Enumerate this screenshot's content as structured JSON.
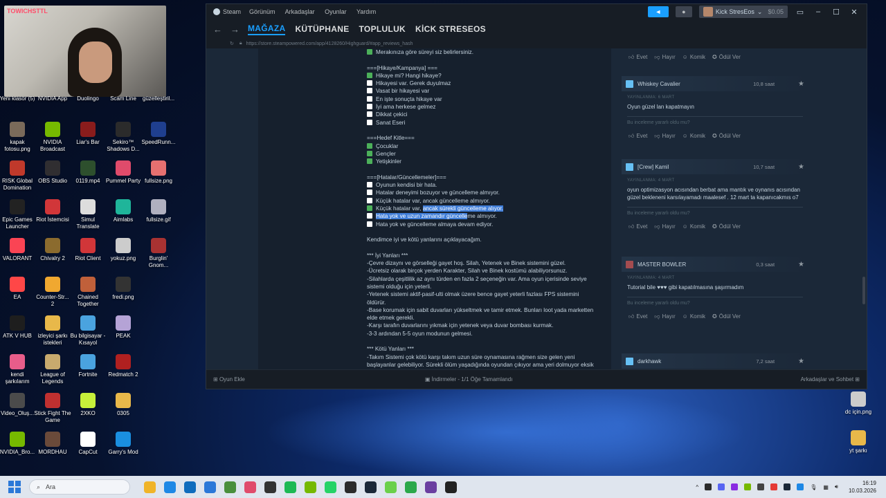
{
  "webcam": {
    "tag": "TOWICHSTTL"
  },
  "desktop_icons": [
    {
      "label": "Yeni klasör (5)",
      "color": "#e8b84a"
    },
    {
      "label": "NVIDIA App",
      "color": "#76b900"
    },
    {
      "label": "Duolingo",
      "color": "#58cc02"
    },
    {
      "label": "Scam Line",
      "color": "#444444"
    },
    {
      "label": "güzelleştiril...",
      "color": "#3a3a3a"
    },
    {
      "label": "kapak fotosu.png",
      "color": "#7a6a5a"
    },
    {
      "label": "NVIDIA Broadcast",
      "color": "#76b900"
    },
    {
      "label": "Liar's Bar",
      "color": "#8a1c1c"
    },
    {
      "label": "Sekiro™ Shadows D...",
      "color": "#2b2b2b"
    },
    {
      "label": "SpeedRunn...",
      "color": "#1f3f8f"
    },
    {
      "label": "RISK Global Domination",
      "color": "#c0392b"
    },
    {
      "label": "OBS Studio",
      "color": "#302e31"
    },
    {
      "label": "0119.mp4",
      "color": "#2d4f2d"
    },
    {
      "label": "Pummel Party",
      "color": "#e04b6b"
    },
    {
      "label": "fullsize.png",
      "color": "#e57070"
    },
    {
      "label": "Epic Games Launcher",
      "color": "#222222"
    },
    {
      "label": "Riot İstemcisi",
      "color": "#d13639"
    },
    {
      "label": "Simul Translate",
      "color": "#dddddd"
    },
    {
      "label": "Aimlabs",
      "color": "#1fb59a"
    },
    {
      "label": "fullsize.gif",
      "color": "#b0b0c0"
    },
    {
      "label": "VALORANT",
      "color": "#fa4454"
    },
    {
      "label": "Chivalry 2",
      "color": "#8b6b2e"
    },
    {
      "label": "Riot Client",
      "color": "#d13639"
    },
    {
      "label": "yokuz.png",
      "color": "#cccccc"
    },
    {
      "label": "Burglin' Gnom...",
      "color": "#a83232"
    },
    {
      "label": "EA",
      "color": "#ff4747"
    },
    {
      "label": "Counter-Str... 2",
      "color": "#f0a830"
    },
    {
      "label": "Chained Together",
      "color": "#c0603a"
    },
    {
      "label": "fredi.png",
      "color": "#333333"
    },
    {
      "label": "ATK V HUB",
      "color": "#1e1e1e"
    },
    {
      "label": "izleyici şarkı istekleri",
      "color": "#e8b84a"
    },
    {
      "label": "Bu bilgisayar - Kısayol",
      "color": "#4aa3df"
    },
    {
      "label": "PEAK",
      "color": "#b5a3d6"
    },
    {
      "label": "kendi şarkılarım",
      "color": "#e85d8a"
    },
    {
      "label": "League of Legends",
      "color": "#c8aa6e"
    },
    {
      "label": "Fortnite",
      "color": "#4aa3df"
    },
    {
      "label": "Redmatch 2",
      "color": "#b02020"
    },
    {
      "label": "Video_Oluş...",
      "color": "#4b4b4b"
    },
    {
      "label": "Stick Fight The Game",
      "color": "#c03030"
    },
    {
      "label": "2XKO",
      "color": "#c6f03a"
    },
    {
      "label": "0305",
      "color": "#e8b84a"
    },
    {
      "label": "NVIDIA_Bro...",
      "color": "#76b900"
    },
    {
      "label": "MORDHAU",
      "color": "#6a4a3a"
    },
    {
      "label": "CapCut",
      "color": "#ffffff"
    },
    {
      "label": "Garry's Mod",
      "color": "#1a8fe0"
    },
    {
      "label": "dc için.png",
      "color": "#cccccc"
    },
    {
      "label": "yt şarkı",
      "color": "#e8b84a"
    }
  ],
  "steam": {
    "title": "Steam",
    "menu": [
      "Görünüm",
      "Arkadaşlar",
      "Oyunlar",
      "Yardım"
    ],
    "user": "Kick StresEos",
    "balance": "$0.05",
    "nav_back": "←",
    "nav_forward": "→",
    "tabs": [
      "MAĞAZA",
      "KÜTÜPHANE",
      "TOPLULUK",
      "KİCK STRESEOS"
    ],
    "active_tab": "MAĞAZA",
    "url": "https://store.steampowered.com/app/4128260/Highguard/#app_reviews_hash",
    "review_lines": [
      {
        "cb": "on",
        "text": "Merakınıza göre süreyi siz belirlersiniz."
      },
      {
        "cb": "",
        "text": ""
      },
      {
        "cb": "",
        "text": "===[Hikaye/Kampanya] ==="
      },
      {
        "cb": "on",
        "text": "Hikaye mi? Hangi hikaye?"
      },
      {
        "cb": "off",
        "text": "Hikayesi var. Gerek duyulmaz"
      },
      {
        "cb": "off",
        "text": "Vasat bir hikayesi var"
      },
      {
        "cb": "off",
        "text": "En işte sonuçta hikaye var"
      },
      {
        "cb": "off",
        "text": "İyi ama herkese gelmez"
      },
      {
        "cb": "off",
        "text": "Dikkat çekici"
      },
      {
        "cb": "off",
        "text": "Sanat Eseri"
      },
      {
        "cb": "",
        "text": ""
      },
      {
        "cb": "",
        "text": "===Hedef Kitle==="
      },
      {
        "cb": "on",
        "text": "Çocuklar"
      },
      {
        "cb": "on",
        "text": "Gençler"
      },
      {
        "cb": "on",
        "text": "Yetişkinler"
      },
      {
        "cb": "",
        "text": ""
      },
      {
        "cb": "",
        "text": "===[Hatalar/Güncellemeler]==="
      },
      {
        "cb": "off",
        "text": "Oyunun kendisi bir hata."
      },
      {
        "cb": "off",
        "text": "Hatalar deneyimi bozuyor ve güncelleme almıyor."
      },
      {
        "cb": "off",
        "text": "Küçük hatalar var, ancak güncelleme almıyor."
      },
      {
        "cb": "on",
        "text": "Küçük hatalar var, ",
        "hl": "ancak sürekli güncelleme alıyor."
      },
      {
        "cb": "off",
        "text": "",
        "hl": "Hata yok ve uzun zamandır güncelle",
        "after": "me almıyor."
      },
      {
        "cb": "off",
        "text": "Hata yok ve güncelleme almaya devam ediyor."
      },
      {
        "cb": "",
        "text": ""
      },
      {
        "cb": "",
        "text": "Kendimce iyi ve kötü yanlarını açıklayacağım."
      },
      {
        "cb": "",
        "text": ""
      },
      {
        "cb": "",
        "text": "*** İyi Yanları ***"
      },
      {
        "cb": "",
        "text": "-Çevre dizaynı ve görselleği gayet hoş. Silah, Yetenek ve Binek sistemini güzel."
      },
      {
        "cb": "",
        "text": "-Ücretsiz olarak birçok yerden Karakter, Silah ve Binek kostümü alabiliyorsunuz."
      },
      {
        "cb": "",
        "text": "-Silahlarda çeşitlilik az aynı türden en fazla 2 seçeneğin var. Ama oyun içerisinde seviye"
      },
      {
        "cb": "",
        "text": "sistemi olduğu için yeterli."
      },
      {
        "cb": "",
        "text": "-Yetenek sistemi aktif-pasif-ulti olmak üzere bence gayet yeterli fazlası FPS sistemini"
      },
      {
        "cb": "",
        "text": "öldürür."
      },
      {
        "cb": "",
        "text": "-Base korumak için sabit duvarları yükseltmek ve tamir etmek. Bunları loot yada marketten"
      },
      {
        "cb": "",
        "text": "elde etmek gerekli."
      },
      {
        "cb": "",
        "text": "-Karşı tarafın duvarlarını yıkmak için yetenek veya duvar bombası kurmak."
      },
      {
        "cb": "",
        "text": "-3-3 ardından 5-5 oyun modunun gelmesi."
      },
      {
        "cb": "",
        "text": ""
      },
      {
        "cb": "",
        "text": "*** Kötü Yanları ***"
      },
      {
        "cb": "",
        "text": "-Takım Sistemi çok kötü karşı takım uzun süre oynamasına rağmen size gelen yeni"
      },
      {
        "cb": "",
        "text": "başlayanlar gelebiliyor. Sürekli ölüm yaşadığında oyundan çıkıyor ama yeri dolmuyor eksik"
      }
    ],
    "vote_labels": {
      "yes": "Evet",
      "no": "Hayır",
      "funny": "Komik",
      "award": "Ödül Ver"
    },
    "helpful_q": "Bu inceleme yararlı oldu mu?",
    "reviews": [
      {
        "name": "Whiskey Cavalier",
        "hours": "10,8 saat",
        "posted": "YAYINLANMA: 6 MART",
        "text": "Oyun güzel lan kapatmayın",
        "thumb": "up"
      },
      {
        "name": "[Crew] Kamil",
        "hours": "10,7 saat",
        "posted": "YAYINLANMA: 4 MART",
        "text": "oyun optimizasyon acısından berbat ama mantık ve oynanıs acısından güzel bekleneni karsılayamadı maalesef . 12 mart ta kapanıcakmıs o7",
        "thumb": "up"
      },
      {
        "name": "MASTER BOWLER",
        "hours": "0,3 saat",
        "posted": "YAYINLANMA: 4 MART",
        "text": "Tutorial bile ♥♥♥ gibi kapatılmasına şaşırmadım",
        "thumb": "down"
      },
      {
        "name": "darkhawk",
        "hours": "7,2 saat",
        "posted": "YAYINLANMA: 1 MART",
        "text": "",
        "thumb": "up"
      }
    ],
    "bottom": {
      "add_game": "Oyun Ekle",
      "downloads": "İndirmeler - 1/1 Öğe Tamamlandı",
      "friends": "Arkadaşlar ve Sohbet"
    }
  },
  "taskbar": {
    "search_placeholder": "Ara",
    "time": "16:19",
    "date": "10.03.2026",
    "apps": [
      "#f0b429",
      "#1e88e5",
      "#0f6cbd",
      "#2b78d8",
      "#4a8f3c",
      "#e04b6b",
      "#333333",
      "#1db954",
      "#76b900",
      "#25d366",
      "#2b2b2b",
      "#1b2838",
      "#6ad04a",
      "#2ba84a",
      "#6b3fa0",
      "#222222"
    ]
  }
}
